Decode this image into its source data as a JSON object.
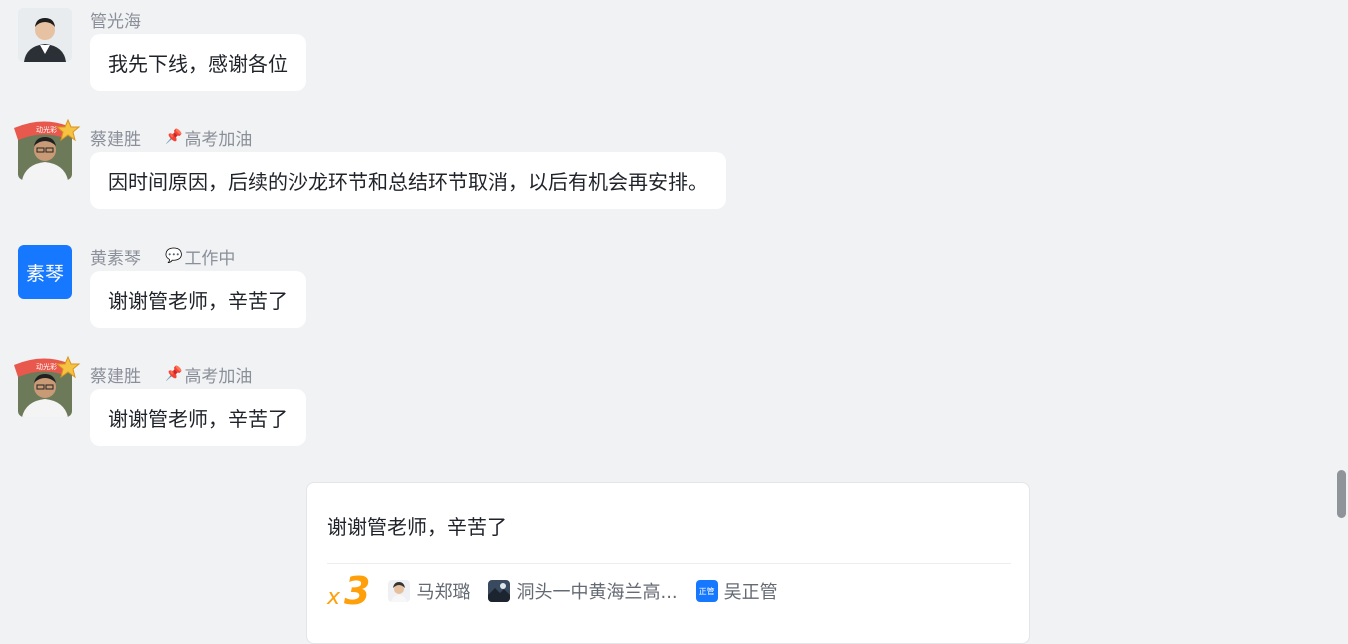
{
  "messages": [
    {
      "sender": "管光海",
      "status_icon": "",
      "status": "",
      "text": "我先下线，感谢各位",
      "avatar": "photo-male-suit"
    },
    {
      "sender": "蔡建胜",
      "status_icon": "pin-icon",
      "status": "高考加油",
      "text": "因时间原因，后续的沙龙环节和总结环节取消，以后有机会再安排。",
      "avatar": "photo-male-glasses"
    },
    {
      "sender": "黄素琴",
      "status_icon": "chat-bubble-icon",
      "status": "工作中",
      "text": "谢谢管老师，辛苦了",
      "avatar_text": "素琴"
    },
    {
      "sender": "蔡建胜",
      "status_icon": "pin-icon",
      "status": "高考加油",
      "text": "谢谢管老师，辛苦了",
      "avatar": "photo-male-glasses"
    }
  ],
  "plus_one_card": {
    "text": "谢谢管老师，辛苦了",
    "multiplier_x": "x",
    "multiplier_n": "3",
    "people": [
      {
        "name": "马郑璐",
        "avatar": "photo-female"
      },
      {
        "name": "洞头一中黄海兰高...",
        "avatar": "photo-landscape"
      },
      {
        "name": "吴正管",
        "avatar_text": "正管"
      }
    ]
  },
  "colors": {
    "accent": "#1677ff",
    "plus_one": "#ff9f0a",
    "background": "#f1f2f4"
  }
}
